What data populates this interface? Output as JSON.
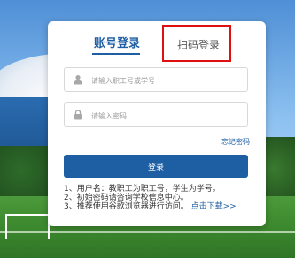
{
  "tabs": {
    "account": "账号登录",
    "qr": "扫码登录"
  },
  "fields": {
    "username_placeholder": "请输入职工号或学号",
    "password_placeholder": "请输入密码"
  },
  "forgot_password": "忘记密码",
  "login_button": "登录",
  "notes": {
    "line1": "1、用户名：教职工为职工号，学生为学号。",
    "line2": "2、初始密码请咨询学校信息中心。",
    "line3": "3、推荐使用谷歌浏览器进行访问。",
    "download_link": "点击下载>>"
  },
  "colors": {
    "primary": "#1e5ea3",
    "highlight_border": "#e01010"
  },
  "icons": {
    "user": "user-icon",
    "lock": "lock-icon"
  }
}
